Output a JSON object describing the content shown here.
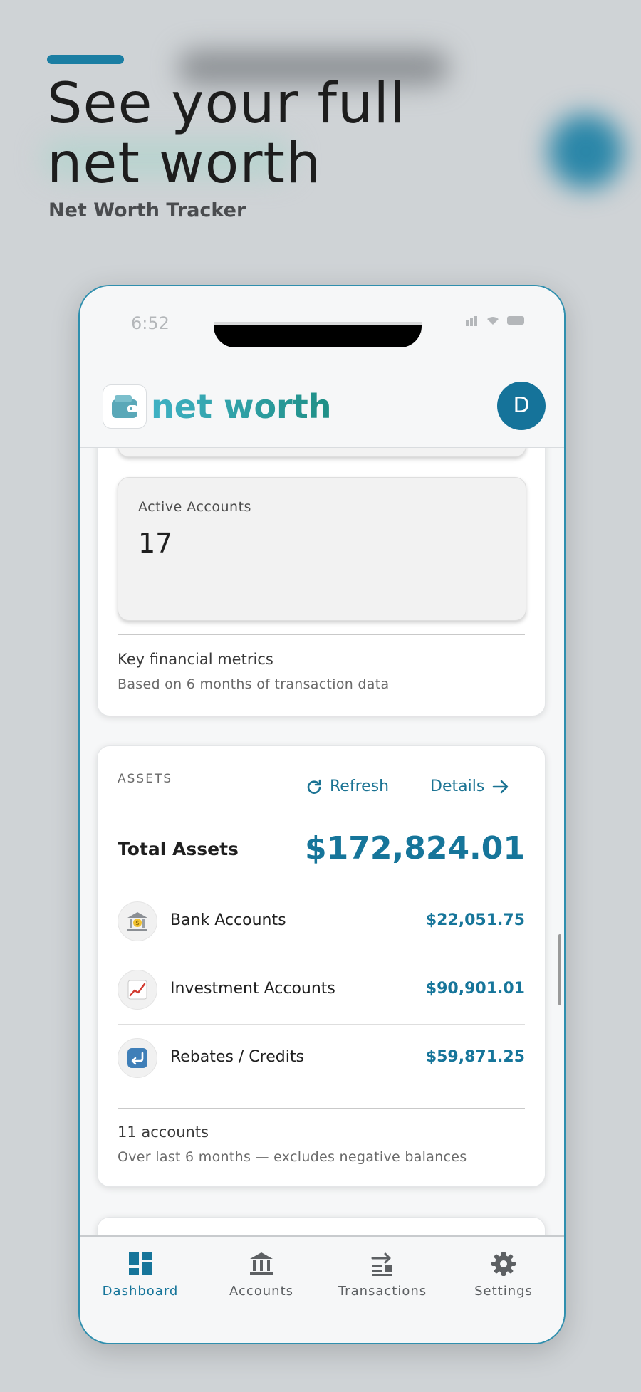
{
  "hero": {
    "headline": "See your full net worth",
    "subtitle": "Net Worth Tracker"
  },
  "status_bar": {
    "time": "6:52"
  },
  "app_bar": {
    "brand": "net worth",
    "avatar_initial": "D",
    "logo_icon": "wallet-icon"
  },
  "metrics_card": {
    "tile": {
      "label": "Active Accounts",
      "value": "17"
    },
    "footer_title": "Key financial metrics",
    "footer_subtitle": "Based on 6 months of transaction data"
  },
  "assets_card": {
    "section_label": "ASSETS",
    "refresh_label": "Refresh",
    "details_label": "Details",
    "total_label": "Total Assets",
    "total_value": "$172,824.01",
    "rows": [
      {
        "icon": "bank-icon",
        "label": "Bank Accounts",
        "value": "$22,051.75"
      },
      {
        "icon": "chart-up-icon",
        "label": "Investment Accounts",
        "value": "$90,901.01"
      },
      {
        "icon": "return-arrow-icon",
        "label": "Rebates / Credits",
        "value": "$59,871.25"
      }
    ],
    "footer_title": "11 accounts",
    "footer_subtitle": "Over last 6 months — excludes negative balances"
  },
  "bottom_nav": {
    "items": [
      {
        "label": "Dashboard",
        "icon": "dashboard-icon",
        "active": true
      },
      {
        "label": "Accounts",
        "icon": "bank-icon",
        "active": false
      },
      {
        "label": "Transactions",
        "icon": "transactions-icon",
        "active": false
      },
      {
        "label": "Settings",
        "icon": "gear-icon",
        "active": false
      }
    ]
  },
  "colors": {
    "accent": "#16759a",
    "brand_gradient_start": "#3fb1c4",
    "brand_gradient_end": "#1f8f86"
  }
}
